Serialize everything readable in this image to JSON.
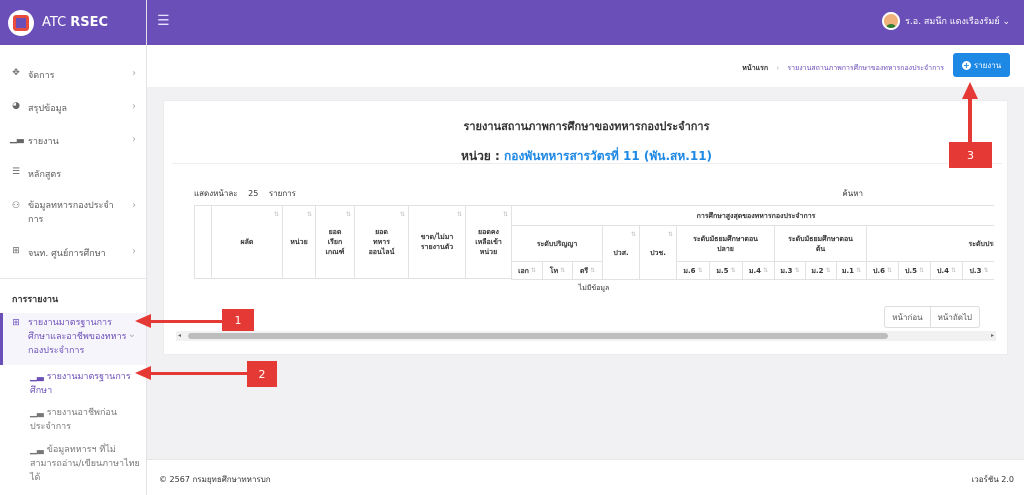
{
  "brand": {
    "prefix": "ATC ",
    "bold": "RSEC"
  },
  "topbar": {
    "user_name": "ร.อ. สมนึก แดงเรืองรัมย์ ⌄"
  },
  "sidebar": {
    "items": [
      {
        "label": "จัดการ",
        "icon": "arrows-icon"
      },
      {
        "label": "สรุปข้อมูล",
        "icon": "pie-chart-icon"
      },
      {
        "label": "รายงาน",
        "icon": "bar-chart-icon"
      },
      {
        "label": "หลักสูตร",
        "icon": "list-icon"
      },
      {
        "label": "ข้อมูลทหารกองประจำการ",
        "icon": "users-icon"
      },
      {
        "label": "จนท. ศูนย์การศึกษา",
        "icon": "grid-icon"
      }
    ],
    "section_title": "การรายงาน",
    "active_item": "รายงานมาตรฐานการศึกษาและอาชีพของทหารกองประจำการ",
    "subitems": [
      "รายงานมาตรฐานการศึกษา",
      "รายงานอาชีพก่อนประจำการ",
      "ข้อมูลทหารฯ ที่ไม่สามารถอ่าน/เขียนภาษาไทยได้"
    ]
  },
  "breadcrumb": {
    "home": "หน้าแรก",
    "current": "รายงานสถานภาพการศึกษาของทหารกองประจำการ"
  },
  "report_button": "รายงาน",
  "report": {
    "title": "รายงานสถานภาพการศึกษาของทหารกองประจำการ",
    "unit_label": "หน่วย : ",
    "unit_value": "กองพันทหารสารวัตรที่ 11 (พัน.สห.11)",
    "show_label": "แสดงหน้าละ",
    "show_count": "25",
    "show_suffix": "รายการ",
    "search_label": "ค้นหา",
    "table": {
      "col_result": "ผลัด",
      "col_unit": "หน่วย",
      "col_called": "ยอดเรียกเกณฑ์",
      "col_online": "ยอดทหารออนไลน์",
      "col_absent": "ขาด/ไม่มารายงานตัว",
      "col_remain": "ยอดคงเหลือเข้าหน่วย",
      "group_highest": "การศึกษาสูงสุดของทหารกองประจำการ",
      "group_degree": "ระดับปริญญา",
      "col_pws": "ปวส.",
      "col_pwch": "ปวช.",
      "group_upper": "ระดับมัธยมศึกษาตอนปลาย",
      "group_lower": "ระดับมัธยมศึกษาตอนต้น",
      "group_primary": "ระดับประถมศึกษา",
      "degree_sub": [
        "เอก",
        "โท",
        "ตรี"
      ],
      "upper_sub": [
        "ม.6",
        "ม.5",
        "ม.4"
      ],
      "lower_sub": [
        "ม.3",
        "ม.2",
        "ม.1"
      ],
      "primary_sub": [
        "ป.6",
        "ป.5",
        "ป.4",
        "ป.3"
      ],
      "no_data": "ไม่มีข้อมูล"
    },
    "pager": {
      "prev": "หน้าก่อน",
      "next": "หน้าถัดไป"
    }
  },
  "footer": {
    "copyright": "© 2567 กรมยุทธศึกษาทหารบก",
    "version": "เวอร์ชัน 2.0"
  },
  "callouts": [
    "1",
    "2",
    "3"
  ],
  "colors": {
    "primary": "#6b4fb8",
    "accent": "#1e88e5",
    "callout": "#e53935"
  }
}
